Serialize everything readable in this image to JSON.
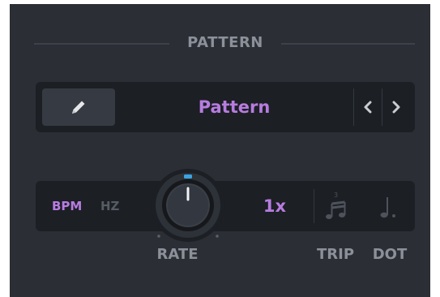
{
  "section": {
    "title": "PATTERN"
  },
  "pattern_selector": {
    "name": "Pattern",
    "edit_icon": "pencil-icon",
    "prev_icon": "chevron-left-icon",
    "next_icon": "chevron-right-icon"
  },
  "rate": {
    "units": [
      "BPM",
      "HZ"
    ],
    "selected_unit": "BPM",
    "value": "1x",
    "label": "RATE",
    "triplet_label": "TRIP",
    "dotted_label": "DOT",
    "triplet_icon": "triplet-notes-icon",
    "dotted_icon": "dotted-note-icon"
  },
  "colors": {
    "accent": "#b77ce0",
    "panel": "#2b2e35",
    "inset": "#1c1f24",
    "knob_indicator": "#3aa3e0",
    "label": "#8b9099",
    "inactive": "#565b64"
  }
}
